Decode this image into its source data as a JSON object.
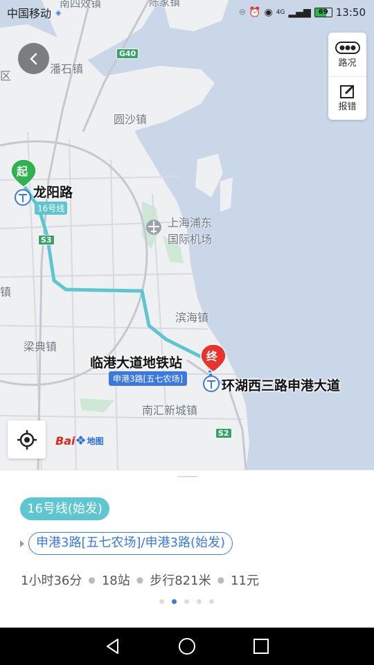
{
  "status_bar": {
    "carrier": "中国移动",
    "carrier_icon": "sim-icon",
    "battery_level": "69",
    "time": "13:50",
    "network": "4G"
  },
  "map_tools": {
    "traffic_label": "路况",
    "report_label": "报错"
  },
  "map_labels": {
    "town_1": "潘石镇",
    "town_2": "圆沙镇",
    "airport_line1": "上海浦东",
    "airport_line2": "国际机场",
    "town_3": "滨海镇",
    "town_4": "梁典镇",
    "town_5": "南汇新城镇",
    "edge_top1": "南四效镇",
    "edge_top2": "陈家镇",
    "edge_left1": "区",
    "edge_left2": "镇",
    "start_station": "龙阳路",
    "transfer_station": "临港大道地铁站",
    "end_station": "环湖西三路申港大道",
    "line_tag": "16号线",
    "bus_tag": "申港3路[五七农场]",
    "start_pin": "起",
    "end_pin": "终",
    "road_g40": "G40",
    "road_s3": "S3",
    "road_s2": "S2"
  },
  "logo": {
    "part1": "Bai",
    "part2": "地图"
  },
  "route": {
    "line_pill": "16号线(始发)",
    "bus_pill": "申港3路[五七农场]/申港3路(始发)",
    "duration": "1小时36分",
    "stops": "18站",
    "walk": "步行821米",
    "fare": "11元"
  },
  "colors": {
    "metro_line": "#5ec6d0",
    "bus_line": "#3b78e0",
    "start_pin": "#2fb24f",
    "end_pin": "#e8332f"
  },
  "pager": {
    "count": 5,
    "active_index": 1
  }
}
